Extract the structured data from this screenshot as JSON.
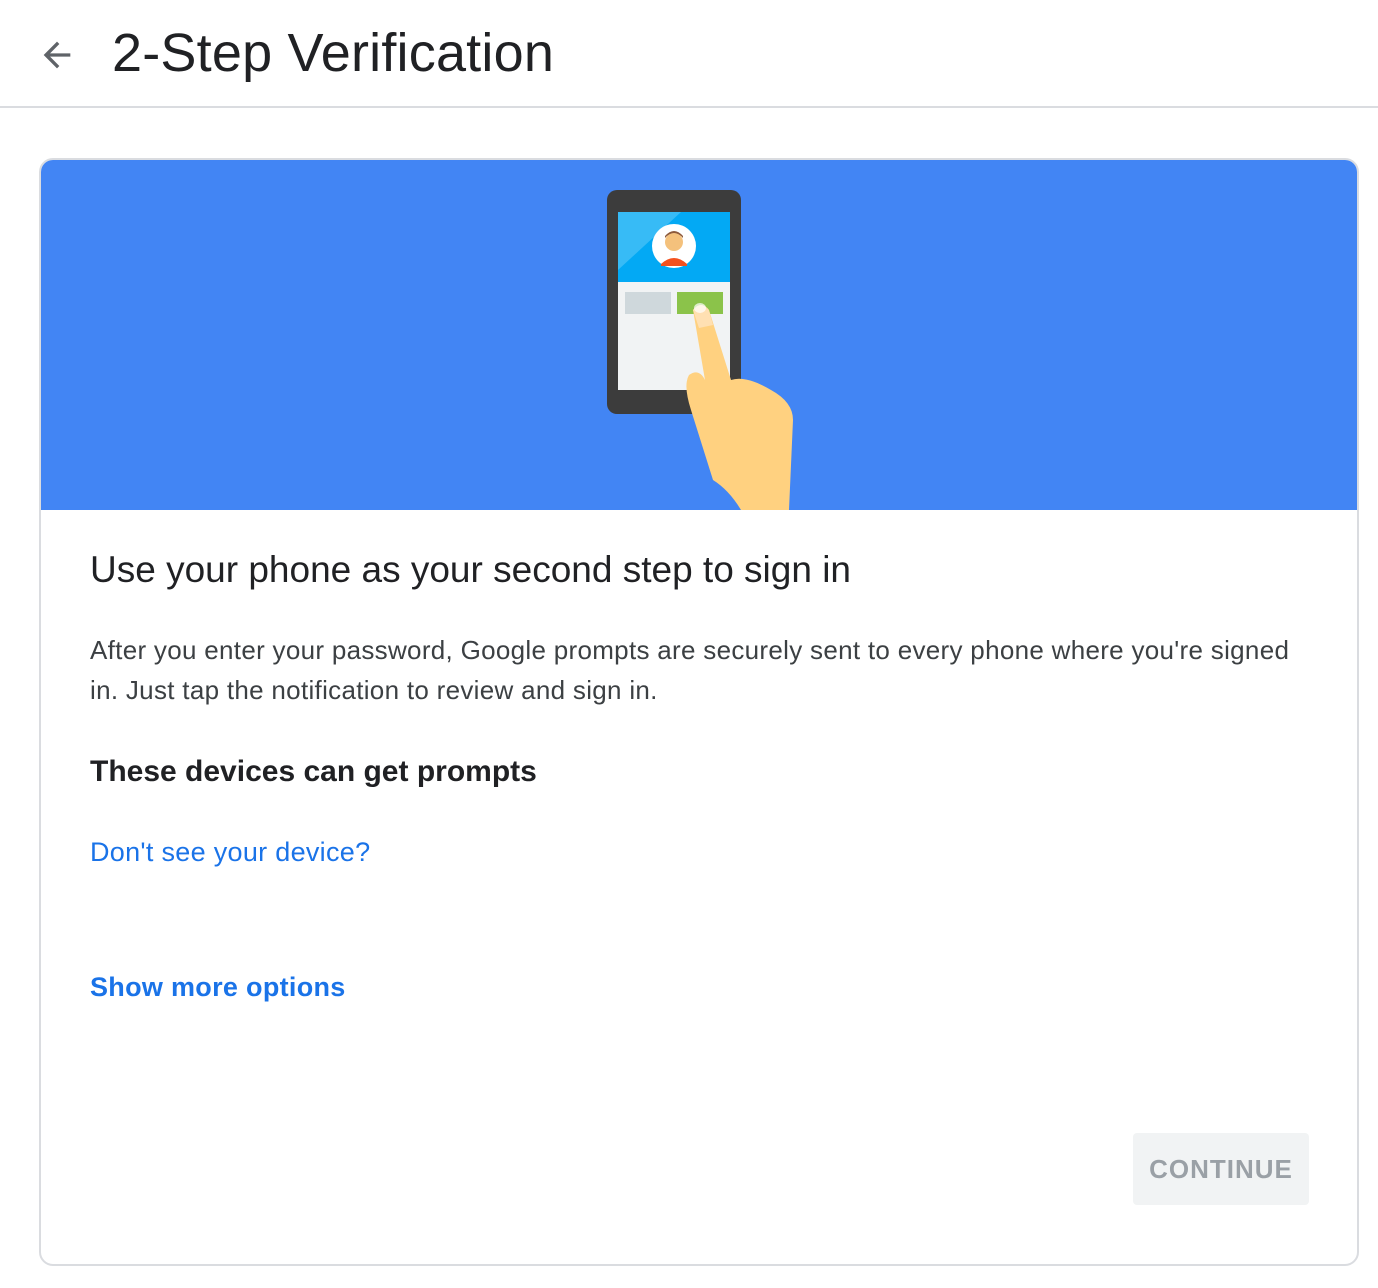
{
  "header": {
    "back_icon": "arrow-back-icon",
    "title": "2-Step Verification"
  },
  "card": {
    "hero_illustration": "phone-tap-illustration",
    "hero_color": "#4285f4",
    "title": "Use your phone as your second step to sign in",
    "description": "After you enter your password, Google prompts are securely sent to every phone where you're signed in. Just tap the notification to review and sign in.",
    "devices_heading": "These devices can get prompts",
    "device_link": "Don't see your device?",
    "more_options": "Show more options",
    "continue_label": "CONTINUE"
  },
  "colors": {
    "link": "#1a73e8",
    "text_primary": "#202124",
    "text_secondary": "#3c4043",
    "button_disabled_bg": "#f1f3f4",
    "button_disabled_text": "#9aa0a6"
  }
}
